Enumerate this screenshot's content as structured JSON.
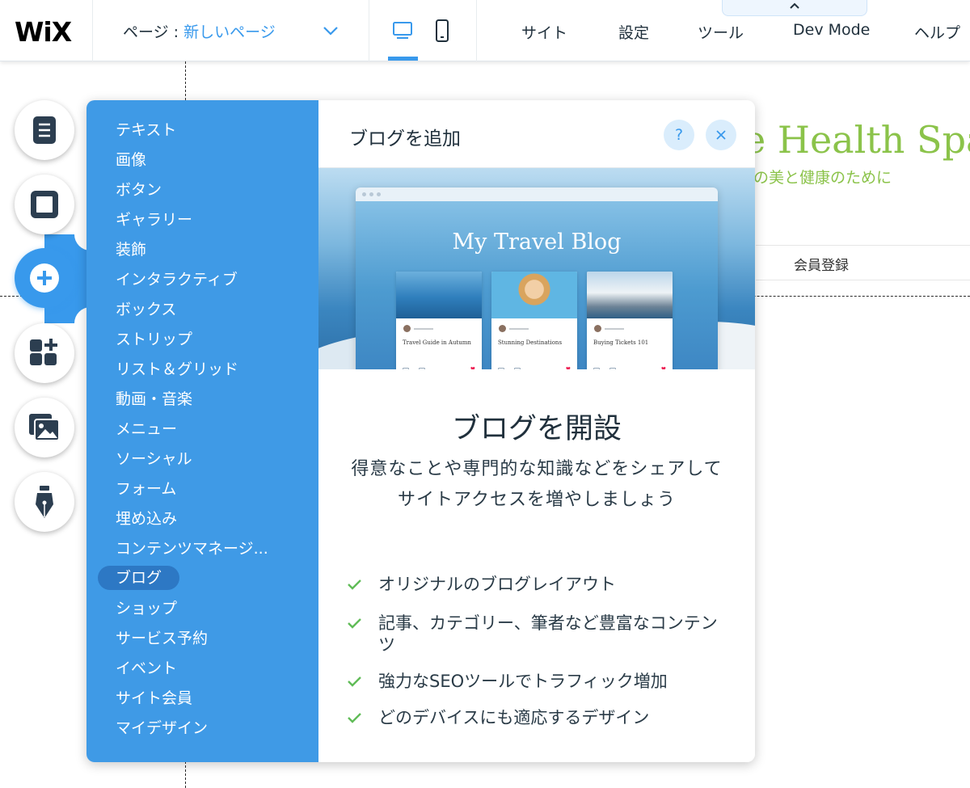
{
  "topbar": {
    "logo": "WiX",
    "page_prefix": "ページ :",
    "page_name": "新しいページ",
    "device_desktop_icon": "desktop-icon",
    "device_mobile_icon": "mobile-icon",
    "menu": [
      "サイト",
      "設定",
      "ツール",
      "Dev Mode",
      "ヘルプ"
    ]
  },
  "site": {
    "title": "e Health Spa",
    "subtitle": "の美と健康のために",
    "nav_item": "会員登録"
  },
  "toolbar": {
    "tools": [
      "pages-icon",
      "background-icon",
      "add-icon",
      "apps-icon",
      "media-icon",
      "pen-icon"
    ],
    "active_tool": "add-icon"
  },
  "add_panel": {
    "categories": [
      "テキスト",
      "画像",
      "ボタン",
      "ギャラリー",
      "装飾",
      "インタラクティブ",
      "ボックス",
      "ストリップ",
      "リスト＆グリッド",
      "動画・音楽",
      "メニュー",
      "ソーシャル",
      "フォーム",
      "埋め込み",
      "コンテンツマネージ...",
      "ブログ",
      "ショップ",
      "サービス予約",
      "イベント",
      "サイト会員",
      "マイデザイン"
    ],
    "selected_category": "ブログ",
    "title": "ブログを追加",
    "help_label": "?",
    "close_label": "×",
    "preview": {
      "blog_title": "My Travel Blog",
      "cards": [
        "Travel Guide in Autumn",
        "Stunning Destinations",
        "Buying Tickets 101"
      ]
    },
    "heading": "ブログを開設",
    "description": "得意なことや専門的な知識などをシェアしてサイトアクセスを増やしましょう",
    "features": [
      "オリジナルのブログレイアウト",
      "記事、カテゴリー、筆者など豊富なコンテンツ",
      "強力なSEOツールでトラフィック増加",
      "どのデバイスにも適応するデザイン"
    ],
    "accent_color": "#3899ec",
    "check_color": "#60bc57"
  }
}
